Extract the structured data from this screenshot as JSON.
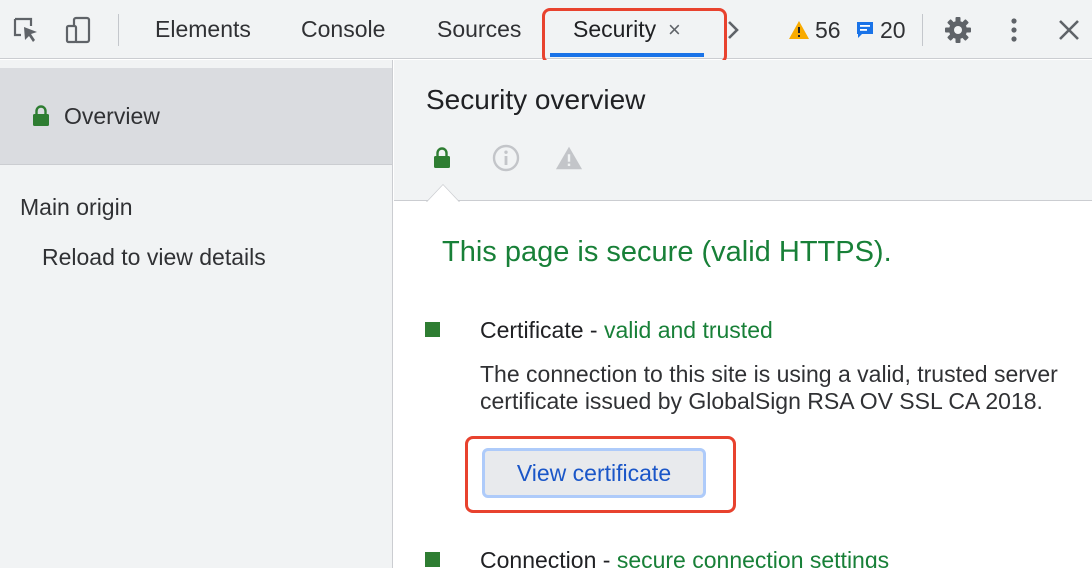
{
  "toolbar": {
    "tabs": [
      {
        "label": "Elements"
      },
      {
        "label": "Console"
      },
      {
        "label": "Sources"
      },
      {
        "label": "Security",
        "active": true
      }
    ],
    "close_glyph": "×",
    "more_tabs_glyph": "›",
    "warnings_count": "56",
    "messages_count": "20",
    "icons": [
      "inspect-element-icon",
      "device-toggle-icon",
      "more-tabs-icon",
      "warning-icon",
      "message-icon",
      "gear-icon",
      "kebab-menu-icon",
      "close-icon"
    ]
  },
  "sidebar": {
    "overview_label": "Overview",
    "main_origin_label": "Main origin",
    "reload_label": "Reload to view details"
  },
  "main": {
    "title": "Security overview",
    "secure_message": "This page is secure (valid HTTPS).",
    "certificate": {
      "title": "Certificate",
      "separator": " - ",
      "status": "valid and trusted",
      "description": "The connection to this site is using a valid, trusted server certificate issued by GlobalSign RSA OV SSL CA 2018.",
      "button_label": "View certificate"
    },
    "connection": {
      "title": "Connection",
      "separator": " - ",
      "status": "secure connection settings"
    }
  },
  "colors": {
    "secure_green": "#188038",
    "accent_blue": "#1a73e8",
    "highlight_red": "#e8422e",
    "warning_yellow": "#f9ab00"
  }
}
